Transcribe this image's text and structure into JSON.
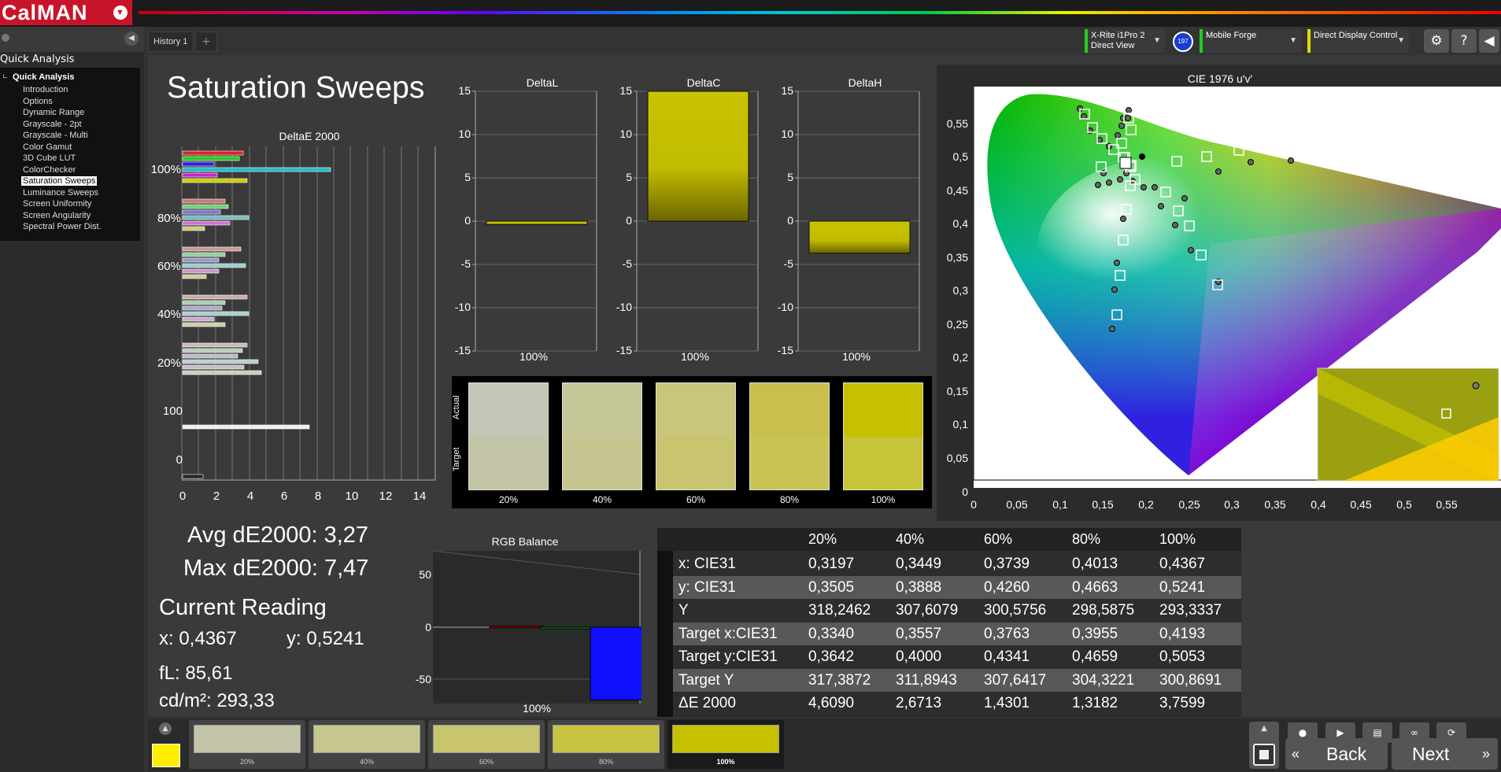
{
  "app": {
    "logo": "CalMAN",
    "logo_menu_icon": "chevron-down-icon"
  },
  "sidebar": {
    "title": "Quick Analysis",
    "section": "Quick Analysis",
    "items": [
      "Introduction",
      "Options",
      "Dynamic Range",
      "Grayscale - 2pt",
      "Grayscale - Multi",
      "Color Gamut",
      "3D Cube LUT",
      "ColorChecker",
      "Saturation Sweeps",
      "Luminance Sweeps",
      "Screen Uniformity",
      "Screen Angularity",
      "Spectral Power Dist."
    ],
    "selected_index": 8
  },
  "tabs": {
    "history": "History 1",
    "add": "+"
  },
  "devices": {
    "meter_line1": "X-Rite i1Pro 2",
    "meter_line2": "Direct View",
    "meter_badge": "197",
    "source": "Mobile Forge",
    "display": "Direct Display Control"
  },
  "page": {
    "title": "Saturation Sweeps"
  },
  "deltae_chart": {
    "title": "DeltaE 2000",
    "y_labels": [
      "100%",
      "80%",
      "60%",
      "40%",
      "20%",
      "100",
      "0"
    ],
    "x_ticks": [
      "0",
      "2",
      "4",
      "6",
      "8",
      "10",
      "12",
      "14"
    ]
  },
  "delta_charts": [
    {
      "title": "DeltaL",
      "value": -0.4,
      "xlabel": "100%"
    },
    {
      "title": "DeltaC",
      "value": 15,
      "xlabel": "100%"
    },
    {
      "title": "DeltaH",
      "value": -3.7,
      "xlabel": "100%"
    }
  ],
  "delta_ticks": [
    "15",
    "10",
    "5",
    "0",
    "-5",
    "-10",
    "-15"
  ],
  "compare": {
    "actual_label": "Actual",
    "target_label": "Target",
    "labels": [
      "20%",
      "40%",
      "60%",
      "80%",
      "100%"
    ],
    "actual_colors": [
      "#c2c6b4",
      "#c6c798",
      "#c9c57a",
      "#c8c04a",
      "#c6c000"
    ],
    "target_colors": [
      "#c3c4a6",
      "#c6c58f",
      "#c8c470",
      "#c9c554",
      "#c8c43a"
    ]
  },
  "stats": {
    "avg": "Avg dE2000: 3,27",
    "max": "Max dE2000: 7,47",
    "current_title": "Current Reading",
    "x": "x: 0,4367",
    "y": "y: 0,5241",
    "fl": "fL: 85,61",
    "cdm": "cd/m²: 293,33"
  },
  "rgb_balance": {
    "title": "RGB Balance",
    "ticks": [
      "50",
      "0",
      "-50"
    ],
    "xlabel": "100%",
    "values": {
      "red": 1,
      "green": -1,
      "blue": -70
    }
  },
  "cie": {
    "title": "CIE 1976 u'v'",
    "y_ticks": [
      "0,55",
      "0,5",
      "0,45",
      "0,4",
      "0,35",
      "0,3",
      "0,25",
      "0,2",
      "0,15",
      "0,1",
      "0,05",
      "0"
    ],
    "x_ticks": [
      "0",
      "0,05",
      "0,1",
      "0,15",
      "0,2",
      "0,25",
      "0,3",
      "0,35",
      "0,4",
      "0,45",
      "0,5",
      "0,55"
    ]
  },
  "table": {
    "headers": [
      "",
      "20%",
      "40%",
      "60%",
      "80%",
      "100%"
    ],
    "rows": [
      [
        "x: CIE31",
        "0,3197",
        "0,3449",
        "0,3739",
        "0,4013",
        "0,4367"
      ],
      [
        "y: CIE31",
        "0,3505",
        "0,3888",
        "0,4260",
        "0,4663",
        "0,5241"
      ],
      [
        "Y",
        "318,2462",
        "307,6079",
        "300,5756",
        "298,5875",
        "293,3337"
      ],
      [
        "Target x:CIE31",
        "0,3340",
        "0,3557",
        "0,3763",
        "0,3955",
        "0,4193"
      ],
      [
        "Target y:CIE31",
        "0,3642",
        "0,4000",
        "0,4341",
        "0,4659",
        "0,5053"
      ],
      [
        "Target Y",
        "317,3872",
        "311,8943",
        "307,6417",
        "304,3221",
        "300,8691"
      ],
      [
        "ΔE 2000",
        "4,6090",
        "2,6713",
        "1,4301",
        "1,3182",
        "3,7599"
      ]
    ]
  },
  "bottom": {
    "swatches": [
      "20%",
      "40%",
      "60%",
      "80%",
      "100%"
    ],
    "back": "Back",
    "next": "Next"
  },
  "colors": {
    "accent": "#c8142a",
    "yellow": "#c6c000",
    "blue": "#1010ff"
  }
}
